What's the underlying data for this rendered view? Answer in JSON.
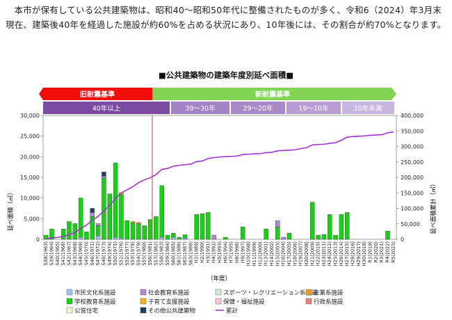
{
  "intro": "本市が保有している公共建築物は、昭和40〜昭和50年代に整備されたものが多く、令和6（2024）年3月末現在、建築後40年を経過した施設が約60%を占める状況にあり、10年後には、その割合が約70%となります。",
  "chart_data": {
    "type": "bar",
    "title": "■公共建築物の建築年度別延べ面積■",
    "xlabel": "（年度）",
    "ylabel": "延べ面積（㎡）",
    "y2label": "延べ面積累計（㎡）",
    "ylim": [
      0,
      30000
    ],
    "y2lim": [
      0,
      400000
    ],
    "yticks": [
      "0",
      "5,000",
      "10,000",
      "15,000",
      "20,000",
      "25,000",
      "30,000"
    ],
    "y2ticks": [
      "0",
      "50,000",
      "100,000",
      "150,000",
      "200,000",
      "250,000",
      "300,000",
      "350,000",
      "400,000"
    ],
    "grid": false,
    "legend_position": "bottom",
    "periods": {
      "old_label": "旧耐震基準",
      "new_label": "新耐震基準",
      "ages": [
        "40年以上",
        "39〜30年",
        "29〜20年",
        "19〜10年",
        "10年未満"
      ]
    },
    "categories": [
      "S38(1963)",
      "S39(1964)",
      "S40(1965)",
      "S41(1966)",
      "S42(1967)",
      "S43(1968)",
      "S44(1969)",
      "S45(1970)",
      "S46(1971)",
      "S47(1972)",
      "S48(1973)",
      "S49(1974)",
      "S50(1975)",
      "S51(1976)",
      "S52(1977)",
      "S53(1978)",
      "S54(1979)",
      "S55(1980)",
      "S56(1981)",
      "S57(1982)",
      "S58(1983)",
      "S59(1984)",
      "S60(1985)",
      "S61(1986)",
      "S62(1987)",
      "S63(1988)",
      "H1(1989)",
      "H2(1990)",
      "H3(1991)",
      "H4(1992)",
      "H5(1993)",
      "H6(1994)",
      "H7(1995)",
      "H8(1996)",
      "H9(1997)",
      "H10(1998)",
      "H11(1999)",
      "H12(2000)",
      "H13(2001)",
      "H14(2002)",
      "H15(2003)",
      "H16(2004)",
      "H17(2005)",
      "H18(2006)",
      "H19(2007)",
      "H20(2008)",
      "H21(2009)",
      "H22(2010)",
      "H23(2011)",
      "H24(2012)",
      "H25(2013)",
      "H26(2014)",
      "H27(2015)",
      "H28(2016)",
      "H29(2017)",
      "H30(2018)",
      "R1(2019)",
      "R2(2020)",
      "R3(2021)",
      "R4(2022)",
      "R5(2023)"
    ],
    "series": [
      {
        "name": "市民文化系施設",
        "color": "#9ec5eb",
        "values": [
          0,
          0,
          0,
          0,
          0,
          0,
          500,
          0,
          0,
          800,
          0,
          0,
          500,
          300,
          0,
          0,
          0,
          0,
          0,
          0,
          500,
          0,
          500,
          0,
          300,
          0,
          0,
          0,
          0,
          0,
          0,
          0,
          0,
          0,
          0,
          0,
          0,
          0,
          0,
          0,
          0,
          0,
          0,
          0,
          0,
          0,
          0,
          0,
          0,
          0,
          0,
          0,
          0,
          0,
          0,
          0,
          0,
          0,
          0,
          0,
          0
        ]
      },
      {
        "name": "学校教育系施設",
        "color": "#11d60f",
        "values": [
          1000,
          2500,
          0,
          2500,
          4300,
          3800,
          9500,
          1800,
          5500,
          2500,
          14800,
          11000,
          18000,
          10500,
          4500,
          4000,
          3800,
          3300,
          4800,
          5500,
          12500,
          1000,
          1000,
          500,
          800,
          0,
          6000,
          6200,
          6500,
          0,
          0,
          500,
          0,
          0,
          3000,
          0,
          0,
          0,
          2500,
          0,
          3000,
          0,
          1500,
          0,
          0,
          0,
          9000,
          1000,
          1200,
          6000,
          1000,
          6000,
          6500,
          0,
          0,
          0,
          0,
          0,
          0,
          2000,
          0
        ]
      },
      {
        "name": "公営住宅",
        "color": "#f7f3c8",
        "values": [
          0,
          0,
          0,
          0,
          0,
          0,
          0,
          0,
          0,
          0,
          0,
          0,
          0,
          0,
          0,
          0,
          0,
          0,
          0,
          0,
          0,
          0,
          0,
          0,
          0,
          0,
          0,
          0,
          0,
          0,
          0,
          0,
          0,
          0,
          0,
          0,
          0,
          0,
          0,
          0,
          0,
          0,
          0,
          0,
          0,
          0,
          0,
          0,
          0,
          0,
          0,
          0,
          0,
          0,
          0,
          0,
          0,
          0,
          0,
          0,
          0
        ]
      },
      {
        "name": "社会教育系施設",
        "color": "#b08ad8",
        "values": [
          0,
          0,
          0,
          0,
          0,
          0,
          0,
          0,
          1000,
          500,
          500,
          0,
          0,
          0,
          0,
          0,
          0,
          0,
          0,
          0,
          0,
          0,
          0,
          0,
          0,
          0,
          0,
          0,
          0,
          1000,
          0,
          0,
          0,
          0,
          0,
          0,
          0,
          0,
          0,
          0,
          1500,
          500,
          0,
          0,
          0,
          0,
          0,
          0,
          0,
          0,
          0,
          0,
          0,
          0,
          0,
          0,
          0,
          0,
          0,
          0,
          0
        ]
      },
      {
        "name": "子育て支援施設",
        "color": "#f1b613",
        "values": [
          0,
          0,
          0,
          0,
          0,
          0,
          0,
          0,
          0,
          0,
          0,
          0,
          0,
          500,
          0,
          300,
          300,
          0,
          0,
          0,
          0,
          0,
          0,
          0,
          0,
          0,
          0,
          0,
          0,
          0,
          0,
          0,
          0,
          0,
          0,
          0,
          0,
          0,
          0,
          0,
          0,
          0,
          0,
          0,
          0,
          0,
          0,
          0,
          0,
          0,
          0,
          0,
          0,
          0,
          0,
          0,
          0,
          0,
          0,
          0,
          0
        ]
      },
      {
        "name": "その他公共建築物",
        "color": "#1f3f5f",
        "values": [
          0,
          0,
          0,
          0,
          0,
          0,
          0,
          0,
          1000,
          0,
          1000,
          0,
          0,
          0,
          0,
          0,
          0,
          0,
          0,
          0,
          0,
          0,
          0,
          0,
          0,
          0,
          0,
          0,
          0,
          0,
          0,
          0,
          0,
          0,
          0,
          0,
          0,
          0,
          0,
          0,
          0,
          0,
          0,
          0,
          0,
          0,
          0,
          0,
          0,
          0,
          0,
          0,
          0,
          0,
          0,
          0,
          0,
          0,
          0,
          0,
          0
        ]
      },
      {
        "name": "スポーツ・レクリエーション系施設",
        "color": "#d4ecd8",
        "values": [
          0,
          0,
          0,
          0,
          0,
          0,
          0,
          0,
          0,
          0,
          0,
          0,
          0,
          0,
          0,
          0,
          0,
          0,
          0,
          0,
          0,
          0,
          0,
          0,
          0,
          0,
          0,
          0,
          0,
          0,
          0,
          0,
          0,
          0,
          0,
          0,
          0,
          0,
          0,
          0,
          0,
          0,
          0,
          0,
          0,
          0,
          0,
          0,
          0,
          0,
          0,
          0,
          0,
          0,
          0,
          0,
          0,
          0,
          0,
          0,
          0
        ]
      },
      {
        "name": "保健・福祉施設",
        "color": "#f9c6dc",
        "values": [
          0,
          0,
          0,
          0,
          0,
          0,
          0,
          0,
          0,
          0,
          0,
          0,
          0,
          0,
          0,
          0,
          0,
          0,
          0,
          0,
          0,
          0,
          0,
          0,
          0,
          0,
          0,
          0,
          0,
          0,
          0,
          0,
          0,
          0,
          0,
          0,
          0,
          0,
          0,
          0,
          0,
          0,
          0,
          0,
          0,
          0,
          0,
          0,
          0,
          0,
          0,
          0,
          0,
          0,
          0,
          0,
          0,
          0,
          0,
          0,
          0
        ]
      },
      {
        "name": "産業系施設",
        "color": "#f29b1a",
        "values": [
          0,
          0,
          0,
          0,
          0,
          0,
          0,
          0,
          0,
          0,
          0,
          0,
          0,
          0,
          0,
          0,
          0,
          0,
          0,
          0,
          0,
          0,
          0,
          0,
          0,
          0,
          0,
          0,
          0,
          0,
          0,
          0,
          0,
          0,
          0,
          0,
          0,
          0,
          0,
          0,
          0,
          0,
          0,
          0,
          0,
          0,
          0,
          0,
          0,
          0,
          0,
          0,
          0,
          0,
          0,
          0,
          0,
          0,
          0,
          0,
          0
        ]
      },
      {
        "name": "行政系施設",
        "color": "#f07f7f",
        "values": [
          0,
          0,
          0,
          0,
          0,
          0,
          0,
          0,
          0,
          0,
          0,
          0,
          0,
          0,
          0,
          0,
          0,
          0,
          0,
          0,
          0,
          0,
          0,
          0,
          0,
          0,
          0,
          0,
          0,
          0,
          0,
          0,
          0,
          0,
          0,
          0,
          0,
          0,
          0,
          0,
          0,
          0,
          0,
          0,
          0,
          0,
          0,
          0,
          0,
          0,
          0,
          0,
          0,
          0,
          0,
          0,
          0,
          0,
          0,
          0,
          0
        ]
      },
      {
        "name": "累計",
        "color": "#a32fd6",
        "type": "line",
        "values": [
          1000,
          5000,
          6000,
          9000,
          15000,
          22000,
          35000,
          46000,
          62000,
          74000,
          92000,
          110000,
          132000,
          150000,
          160000,
          170000,
          183000,
          192000,
          199000,
          209000,
          226000,
          229000,
          236000,
          239000,
          241000,
          243000,
          251000,
          253000,
          261000,
          264000,
          266000,
          267000,
          268000,
          269000,
          274000,
          275000,
          276000,
          277000,
          280000,
          281000,
          286000,
          287000,
          288000,
          289000,
          293000,
          296000,
          305000,
          306000,
          307000,
          310000,
          312000,
          320000,
          330000,
          332000,
          333000,
          334000,
          336000,
          337000,
          338000,
          344000,
          347000
        ]
      }
    ]
  }
}
